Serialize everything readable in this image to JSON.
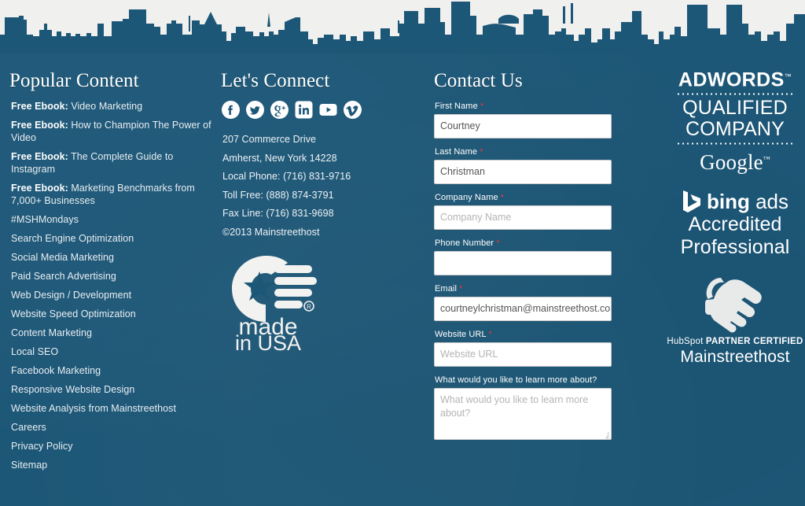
{
  "theme": {
    "background_color": "#1d5777",
    "sky_color": "#f0f0ee",
    "text_color": "#e9eef2",
    "required_color": "#e03a3a",
    "input_background": "#ffffff"
  },
  "popular": {
    "heading": "Popular Content",
    "items": [
      {
        "prefix": "Free Ebook:",
        "label": " Video Marketing"
      },
      {
        "prefix": "Free Ebook:",
        "label": " How to Champion The Power of Video"
      },
      {
        "prefix": "Free Ebook:",
        "label": " The Complete Guide to Instagram"
      },
      {
        "prefix": "Free Ebook:",
        "label": " Marketing Benchmarks from 7,000+ Businesses"
      },
      {
        "prefix": "",
        "label": "#MSHMondays"
      },
      {
        "prefix": "",
        "label": "Search Engine Optimization"
      },
      {
        "prefix": "",
        "label": "Social Media Marketing"
      },
      {
        "prefix": "",
        "label": "Paid Search Advertising"
      },
      {
        "prefix": "",
        "label": "Web Design / Development"
      },
      {
        "prefix": "",
        "label": "Website Speed Optimization"
      },
      {
        "prefix": "",
        "label": "Content Marketing"
      },
      {
        "prefix": "",
        "label": "Local SEO"
      },
      {
        "prefix": "",
        "label": "Facebook Marketing"
      },
      {
        "prefix": "",
        "label": "Responsive Website Design"
      },
      {
        "prefix": "",
        "label": "Website Analysis from Mainstreethost"
      },
      {
        "prefix": "",
        "label": "Careers"
      },
      {
        "prefix": "",
        "label": "Privacy Policy"
      },
      {
        "prefix": "",
        "label": "Sitemap"
      }
    ]
  },
  "connect": {
    "heading": "Let's Connect",
    "social": [
      {
        "name": "facebook-icon",
        "label": "Facebook"
      },
      {
        "name": "twitter-icon",
        "label": "Twitter"
      },
      {
        "name": "google-plus-icon",
        "label": "Google Plus"
      },
      {
        "name": "linkedin-icon",
        "label": "LinkedIn"
      },
      {
        "name": "youtube-icon",
        "label": "YouTube"
      },
      {
        "name": "vimeo-icon",
        "label": "Vimeo"
      }
    ],
    "address_line1": "207 Commerce Drive",
    "address_line2": "Amherst, New York 14228",
    "local_phone": "Local Phone: (716) 831-9716",
    "toll_free": "Toll Free: (888) 874-3791",
    "fax_line": "Fax Line: (716) 831-9698",
    "copyright": "©2013 Mainstreethost",
    "made_in_usa": {
      "line1": "made",
      "line2": "in USA",
      "registered": "®"
    }
  },
  "contact": {
    "heading": "Contact Us",
    "fields": [
      {
        "label": "First Name",
        "required": true,
        "value": "Courtney",
        "placeholder": "First Name",
        "type": "text"
      },
      {
        "label": "Last Name",
        "required": true,
        "value": "Christman",
        "placeholder": "Last Name",
        "type": "text"
      },
      {
        "label": "Company Name",
        "required": true,
        "value": "",
        "placeholder": "Company Name",
        "type": "text"
      },
      {
        "label": "Phone Number",
        "required": true,
        "value": "",
        "placeholder": "",
        "type": "text"
      },
      {
        "label": "Email",
        "required": true,
        "value": "courtneylchristman@mainstreethost.com",
        "placeholder": "Email",
        "type": "text"
      },
      {
        "label": "Website URL",
        "required": true,
        "value": "",
        "placeholder": "Website URL",
        "type": "text"
      },
      {
        "label": "What would you like to learn more about?",
        "required": false,
        "value": "",
        "placeholder": "What would you like to learn more about?",
        "type": "textarea"
      }
    ]
  },
  "badges": {
    "adwords": {
      "line1": "ADWORDS",
      "trademark": "™",
      "line2": "QUALIFIED",
      "line3": "COMPANY",
      "brand": "Google",
      "brand_trademark": "™"
    },
    "bing": {
      "brand_bold": "bing",
      "brand_light": "ads",
      "line2": "Accredited",
      "line3": "Professional"
    },
    "hubspot": {
      "brand": "HubSpot",
      "certification": "PARTNER CERTIFIED",
      "company": "Mainstreethost"
    }
  }
}
